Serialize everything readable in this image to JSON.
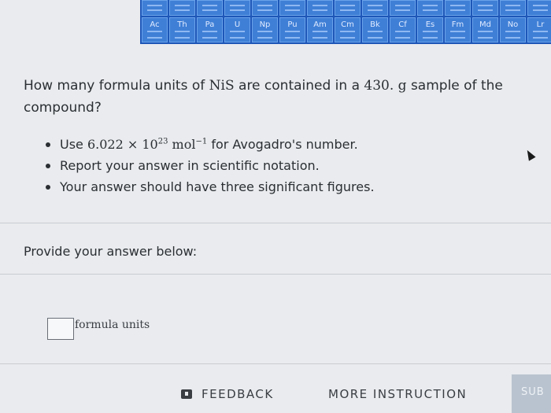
{
  "periodic_table": {
    "elements": [
      "Ac",
      "Th",
      "Pa",
      "U",
      "Np",
      "Pu",
      "Am",
      "Cm",
      "Bk",
      "Cf",
      "Es",
      "Fm",
      "Md",
      "No",
      "Lr"
    ]
  },
  "question": {
    "text_before": "How many formula units of ",
    "formula": "NiS",
    "text_middle": " are contained in a ",
    "mass": "430. g",
    "text_after": " sample of the compound?"
  },
  "bullets": {
    "b1_prefix": "Use ",
    "avogadro_mantissa": "6.022 × 10",
    "avogadro_exp": "23",
    "unit": " mol",
    "unit_exp": "−1",
    "b1_suffix": " for Avogadro's number.",
    "b2": "Report your answer in scientific notation.",
    "b3": "Your answer should have three significant figures."
  },
  "answer": {
    "prompt": "Provide your answer below:",
    "value": "",
    "unit_label": "formula units"
  },
  "footer": {
    "feedback_label": "FEEDBACK",
    "more_label": "MORE INSTRUCTION",
    "submit_label": "SUB"
  }
}
